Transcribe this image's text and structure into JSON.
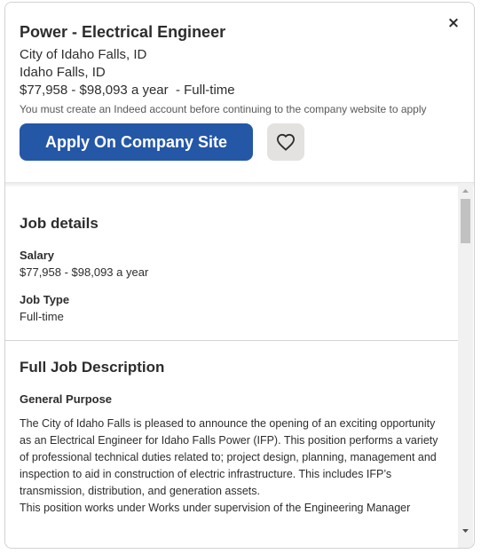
{
  "header": {
    "job_title": "Power - Electrical Engineer",
    "company": "City of Idaho Falls, ID",
    "location": "Idaho Falls, ID",
    "salary_type": "$77,958 - $98,093 a year  - Full-time",
    "notice": "You must create an Indeed account before continuing to the company website to apply",
    "apply_label": "Apply On Company Site",
    "save_icon": "heart-icon",
    "close_label": "×"
  },
  "job_details": {
    "heading": "Job details",
    "salary_label": "Salary",
    "salary_value": "$77,958 - $98,093 a year",
    "job_type_label": "Job Type",
    "job_type_value": "Full-time"
  },
  "description": {
    "heading": "Full Job Description",
    "subheading": "General Purpose",
    "paragraph": "The City of Idaho Falls is pleased to announce the opening of an exciting opportunity as an Electrical Engineer for Idaho Falls Power (IFP). This position performs a variety of professional technical duties related to; project design, planning, management and inspection to aid in construction of electric infrastructure. This includes IFP’s transmission, distribution, and generation assets.",
    "line2": "This position works under Works under supervision of the Engineering Manager"
  },
  "colors": {
    "accent": "#2557a7",
    "save_bg": "#e4e2e0"
  }
}
